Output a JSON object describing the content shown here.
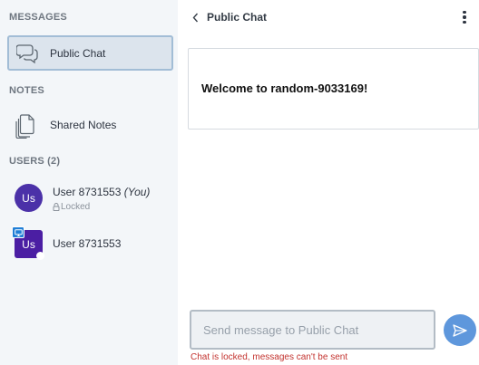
{
  "sidebar": {
    "messages_title": "MESSAGES",
    "public_chat_label": "Public Chat",
    "notes_title": "NOTES",
    "shared_notes_label": "Shared Notes",
    "users_title": "USERS (2)",
    "users": [
      {
        "initials": "Us",
        "name": "User 8731553",
        "you_tag": "(You)",
        "status": "Locked"
      },
      {
        "initials": "Us",
        "name": "User 8731553"
      }
    ]
  },
  "chat": {
    "title": "Public Chat",
    "welcome_prefix": "Welcome to ",
    "room_name": "random-9033169",
    "welcome_suffix": "!",
    "input_placeholder": "Send message to Public Chat",
    "locked_message": "Chat is locked, messages can't be sent"
  },
  "colors": {
    "sidebar_bg": "#f3f6f9",
    "selected_item_bg": "#dce4ed",
    "avatar_self": "#4b31a8",
    "avatar_other": "#4b1ea3",
    "send_button": "#5e97dc",
    "error_text": "#c3332f"
  },
  "icons": {
    "public_chat": "chat-bubbles-icon",
    "shared_notes": "documents-icon",
    "back": "chevron-left-icon",
    "more": "more-vertical-icon",
    "lock": "lock-icon",
    "presenter": "presentation-icon",
    "send": "send-icon"
  }
}
